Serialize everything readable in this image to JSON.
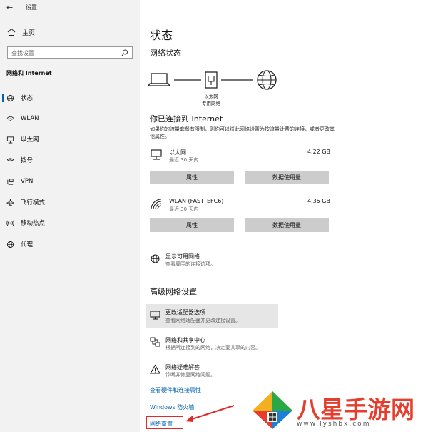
{
  "window": {
    "title": "设置",
    "back_glyph": "←"
  },
  "sidebar": {
    "home_label": "主页",
    "search_placeholder": "查找设置",
    "section_title": "网络和 Internet",
    "items": [
      {
        "label": "状态",
        "icon": "globe-status-icon",
        "selected": true
      },
      {
        "label": "WLAN",
        "icon": "wifi-icon"
      },
      {
        "label": "以太网",
        "icon": "ethernet-icon"
      },
      {
        "label": "拨号",
        "icon": "dialup-icon"
      },
      {
        "label": "VPN",
        "icon": "vpn-icon"
      },
      {
        "label": "飞行模式",
        "icon": "airplane-icon"
      },
      {
        "label": "移动热点",
        "icon": "hotspot-icon"
      },
      {
        "label": "代理",
        "icon": "proxy-globe-icon"
      }
    ]
  },
  "main": {
    "title": "状态",
    "network_status_title": "网络状态",
    "diagram_label_1": "以太网",
    "diagram_label_2": "专用网络",
    "connected_title": "你已连接到 Internet",
    "connected_desc": "如果你的流量套餐有限制，则你可以将此网络设置为按流量计费的连接，或者更改其他属性。",
    "adapters": [
      {
        "name": "以太网",
        "sub": "最近 30 天内",
        "usage": "4.22 GB",
        "btn_props": "属性",
        "btn_usage": "数据使用量"
      },
      {
        "name": "WLAN (FAST_EFC6)",
        "sub": "最近 30 天内",
        "usage": "4.35 GB",
        "btn_props": "属性",
        "btn_usage": "数据使用量"
      }
    ],
    "show_networks": {
      "title": "显示可用网络",
      "sub": "查看周围的连接选项。"
    },
    "advanced_title": "高级网络设置",
    "advanced": [
      {
        "title": "更改适配器选项",
        "sub": "查看网络适配器并更改连接设置。"
      },
      {
        "title": "网络和共享中心",
        "sub": "根据所连接到的网络，决定要共享的内容。"
      },
      {
        "title": "网络疑难解答",
        "sub": "诊断并修复网络问题。"
      }
    ],
    "links": {
      "hardware": "查看硬件和连接属性",
      "firewall": "Windows 防火墙",
      "reset": "网络重置"
    }
  },
  "watermark": {
    "text": "八星手游网",
    "url": "www.lyshbx.com"
  },
  "colors": {
    "accent": "#0063b1",
    "highlight_box": "#e02a2a",
    "button_bg": "#cccccc",
    "sidebar_bg": "#f2f2f2"
  }
}
